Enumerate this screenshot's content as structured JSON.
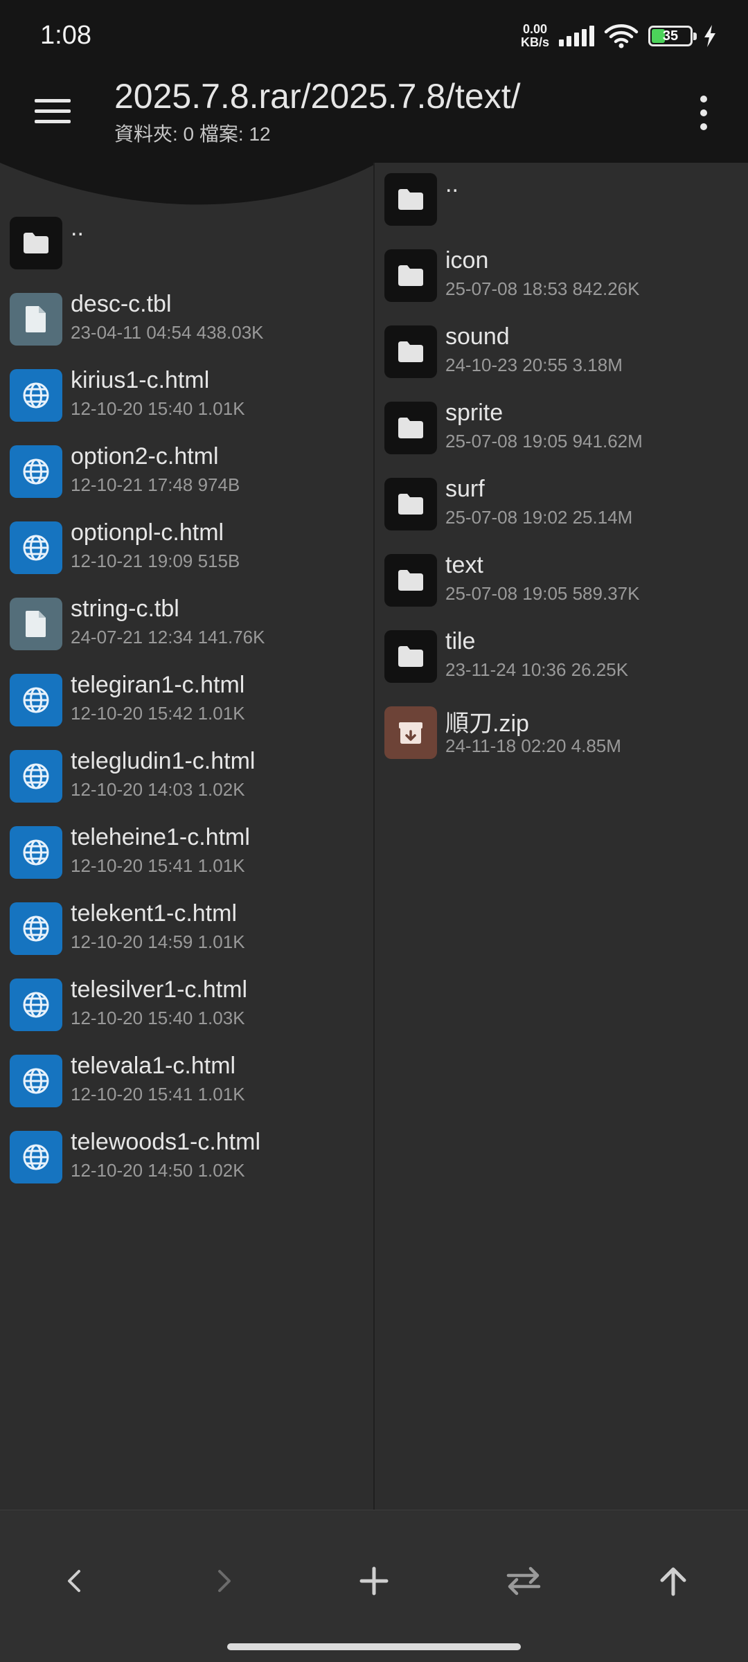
{
  "status_bar": {
    "time": "1:08",
    "net_speed_value": "0.00",
    "net_speed_unit": "KB/s",
    "battery_level": "35"
  },
  "header": {
    "path": "2025.7.8.rar/2025.7.8/text/",
    "counts": "資料夾: 0  檔案: 12"
  },
  "left_pane": {
    "up_label": "..",
    "items": [
      {
        "name": "desc-c.tbl",
        "meta": "23-04-11 04:54  438.03K",
        "type": "doc"
      },
      {
        "name": "kirius1-c.html",
        "meta": "12-10-20 15:40  1.01K",
        "type": "web"
      },
      {
        "name": "option2-c.html",
        "meta": "12-10-21 17:48  974B",
        "type": "web"
      },
      {
        "name": "optionpl-c.html",
        "meta": "12-10-21 19:09  515B",
        "type": "web"
      },
      {
        "name": "string-c.tbl",
        "meta": "24-07-21 12:34  141.76K",
        "type": "doc"
      },
      {
        "name": "telegiran1-c.html",
        "meta": "12-10-20 15:42  1.01K",
        "type": "web"
      },
      {
        "name": "telegludin1-c.html",
        "meta": "12-10-20 14:03  1.02K",
        "type": "web"
      },
      {
        "name": "teleheine1-c.html",
        "meta": "12-10-20 15:41  1.01K",
        "type": "web"
      },
      {
        "name": "telekent1-c.html",
        "meta": "12-10-20 14:59  1.01K",
        "type": "web"
      },
      {
        "name": "telesilver1-c.html",
        "meta": "12-10-20 15:40  1.03K",
        "type": "web"
      },
      {
        "name": "televala1-c.html",
        "meta": "12-10-20 15:41  1.01K",
        "type": "web"
      },
      {
        "name": "telewoods1-c.html",
        "meta": "12-10-20 14:50  1.02K",
        "type": "web"
      }
    ]
  },
  "right_pane": {
    "up_label": "..",
    "items": [
      {
        "name": "icon",
        "meta": "25-07-08 18:53  842.26K",
        "type": "folder"
      },
      {
        "name": "sound",
        "meta": "24-10-23 20:55  3.18M",
        "type": "folder"
      },
      {
        "name": "sprite",
        "meta": "25-07-08 19:05  941.62M",
        "type": "folder"
      },
      {
        "name": "surf",
        "meta": "25-07-08 19:02  25.14M",
        "type": "folder"
      },
      {
        "name": "text",
        "meta": "25-07-08 19:05  589.37K",
        "type": "folder"
      },
      {
        "name": "tile",
        "meta": "23-11-24 10:36  26.25K",
        "type": "folder"
      },
      {
        "name": "順刀.zip",
        "meta": "24-11-18 02:20  4.85M",
        "type": "zip"
      }
    ]
  },
  "bottom_nav": {
    "buttons": [
      "back-icon",
      "forward-icon",
      "add-icon",
      "swap-icon",
      "up-icon"
    ]
  },
  "colors": {
    "background": "#2d2d2d",
    "header": "#151515",
    "folder_tile": "#111111",
    "doc_tile": "#546e7a",
    "web_tile": "#1674c0",
    "zip_tile": "#6d4337",
    "battery_fill": "#4cd35a"
  }
}
